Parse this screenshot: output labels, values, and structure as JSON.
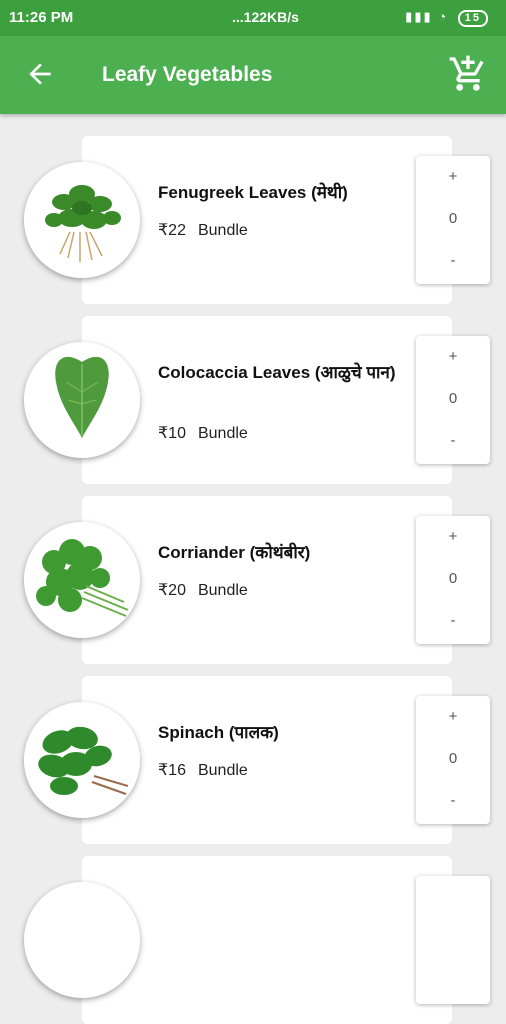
{
  "status_bar": {
    "time": "11:26 PM",
    "network": "...122KB/s",
    "battery": "15"
  },
  "app_bar": {
    "title": "Leafy Vegetables",
    "back_icon": "arrow-back-icon",
    "cart_icon": "add-to-cart-icon"
  },
  "items": [
    {
      "name": "Fenugreek Leaves (मेथी)",
      "price": "₹22",
      "unit": "Bundle",
      "plus": "+",
      "qty": "0",
      "minus": "-"
    },
    {
      "name": "Colocaccia Leaves (आळुचे पान)",
      "price": "₹10",
      "unit": "Bundle",
      "plus": "+",
      "qty": "0",
      "minus": "-"
    },
    {
      "name": "Corriander (कोथंबीर)",
      "price": "₹20",
      "unit": "Bundle",
      "plus": "+",
      "qty": "0",
      "minus": "-"
    },
    {
      "name": "Spinach (पालक)",
      "price": "₹16",
      "unit": "Bundle",
      "plus": "+",
      "qty": "0",
      "minus": "-"
    }
  ],
  "colors": {
    "status_bar": "#3da03f",
    "app_bar": "#4caf50",
    "background": "#ededed"
  }
}
